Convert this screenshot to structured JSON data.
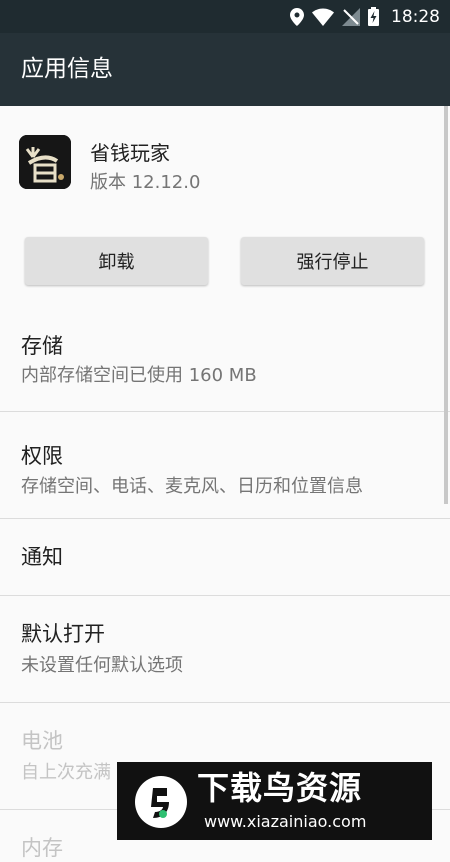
{
  "status_bar": {
    "time": "18:28",
    "icons": [
      "location-icon",
      "wifi-icon",
      "no-signal-icon",
      "battery-charging-icon"
    ]
  },
  "app_bar": {
    "title": "应用信息"
  },
  "app": {
    "name": "省钱玩家",
    "version": "版本 12.12.0",
    "icon": "app-logo-icon"
  },
  "buttons": {
    "uninstall": "卸载",
    "force_stop": "强行停止"
  },
  "settings": [
    {
      "title": "存储",
      "summary": "内部存储空间已使用 160 MB",
      "enabled": true
    },
    {
      "title": "权限",
      "summary": "存储空间、电话、麦克风、日历和位置信息",
      "enabled": true
    },
    {
      "title": "通知",
      "summary": "",
      "enabled": true
    },
    {
      "title": "默认打开",
      "summary": "未设置任何默认选项",
      "enabled": true
    },
    {
      "title": "电池",
      "summary": "自上次充满",
      "enabled": false
    },
    {
      "title": "内存",
      "summary": "",
      "enabled": false
    }
  ],
  "watermark": {
    "text": "下载鸟资源",
    "url": "www.xiazainiao.com"
  },
  "colors": {
    "status_bar": "#1f2b30",
    "app_bar": "#263238",
    "background": "#fafafa",
    "button": "#e0e0e0",
    "secondary_text": "#757575"
  }
}
